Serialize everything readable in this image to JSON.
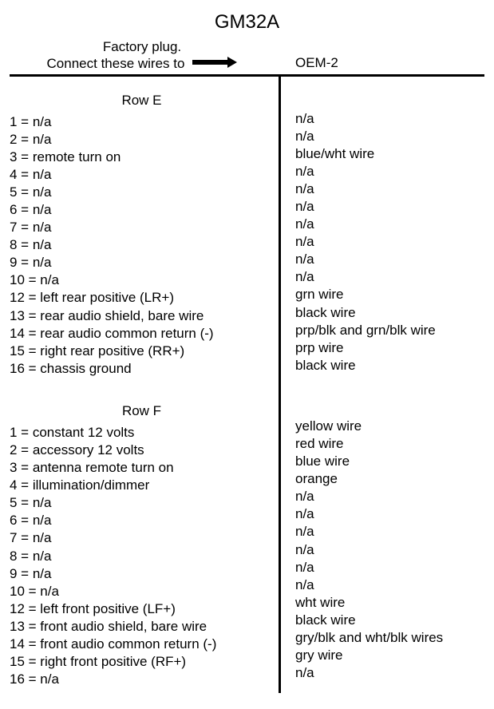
{
  "title": "GM32A",
  "header": {
    "left_line1": "Factory plug.",
    "left_line2": "Connect these wires to",
    "right_label": "OEM-2"
  },
  "sections": [
    {
      "name": "Row E",
      "rows": [
        {
          "num": "1",
          "left": "n/a",
          "right": "n/a"
        },
        {
          "num": "2",
          "left": "n/a",
          "right": "n/a"
        },
        {
          "num": "3",
          "left": "remote turn on",
          "right": "blue/wht wire"
        },
        {
          "num": "4",
          "left": "n/a",
          "right": "n/a"
        },
        {
          "num": "5",
          "left": "n/a",
          "right": "n/a"
        },
        {
          "num": "6",
          "left": "n/a",
          "right": "n/a"
        },
        {
          "num": "7",
          "left": "n/a",
          "right": "n/a"
        },
        {
          "num": "8",
          "left": "n/a",
          "right": "n/a"
        },
        {
          "num": "9",
          "left": "n/a",
          "right": "n/a"
        },
        {
          "num": "10",
          "left": "n/a",
          "right": "n/a"
        },
        {
          "num": "12",
          "left": "left rear positive (LR+)",
          "right": "grn wire"
        },
        {
          "num": "13",
          "left": "rear audio shield, bare wire",
          "right": "black wire"
        },
        {
          "num": "14",
          "left": "rear audio common return (-)",
          "right": "prp/blk and grn/blk wire"
        },
        {
          "num": "15",
          "left": "right rear positive (RR+)",
          "right": "prp wire"
        },
        {
          "num": "16",
          "left": "chassis ground",
          "right": "black wire"
        }
      ]
    },
    {
      "name": "Row F",
      "rows": [
        {
          "num": "1",
          "left": "constant 12 volts",
          "right": "yellow wire"
        },
        {
          "num": "2",
          "left": "accessory 12 volts",
          "right": "red wire"
        },
        {
          "num": "3",
          "left": "antenna remote turn on",
          "right": "blue wire"
        },
        {
          "num": "4",
          "left": "illumination/dimmer",
          "right": "orange"
        },
        {
          "num": "5",
          "left": "n/a",
          "right": "n/a"
        },
        {
          "num": "6",
          "left": "n/a",
          "right": "n/a"
        },
        {
          "num": "7",
          "left": "n/a",
          "right": "n/a"
        },
        {
          "num": "8",
          "left": "n/a",
          "right": "n/a"
        },
        {
          "num": "9",
          "left": "n/a",
          "right": "n/a"
        },
        {
          "num": "10",
          "left": "n/a",
          "right": "n/a"
        },
        {
          "num": "12",
          "left": "left front positive (LF+)",
          "right": "wht wire"
        },
        {
          "num": "13",
          "left": "front audio shield, bare wire",
          "right": "black wire"
        },
        {
          "num": "14",
          "left": "front audio common return (-)",
          "right": "gry/blk and wht/blk wires"
        },
        {
          "num": "15",
          "left": "right front positive (RF+)",
          "right": "gry wire"
        },
        {
          "num": "16",
          "left": "n/a",
          "right": "n/a"
        }
      ]
    }
  ]
}
